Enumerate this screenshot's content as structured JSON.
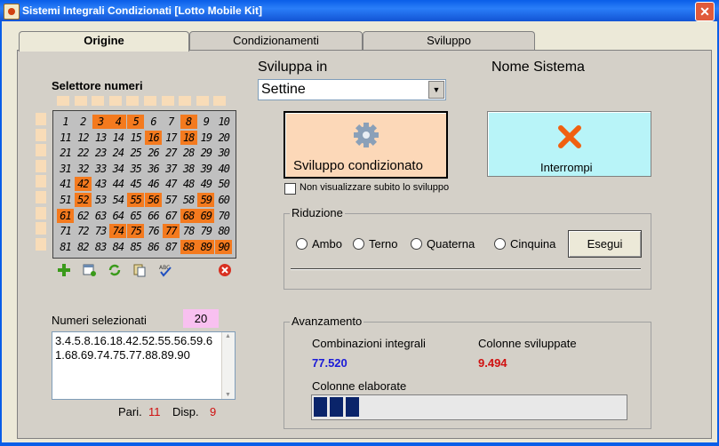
{
  "window": {
    "title": "Sistemi Integrali Condizionati  [Lotto Mobile Kit]",
    "close_glyph": "✕"
  },
  "tabs": [
    {
      "label": "Origine"
    },
    {
      "label": "Condizionamenti"
    },
    {
      "label": "Sviluppo"
    }
  ],
  "selector": {
    "title": "Selettore numeri",
    "rows": [
      [
        1,
        2,
        3,
        4,
        5,
        6,
        7,
        8,
        9,
        10
      ],
      [
        11,
        12,
        13,
        14,
        15,
        16,
        17,
        18,
        19,
        20
      ],
      [
        21,
        22,
        23,
        24,
        25,
        26,
        27,
        28,
        29,
        30
      ],
      [
        31,
        32,
        33,
        34,
        35,
        36,
        37,
        38,
        39,
        40
      ],
      [
        41,
        42,
        43,
        44,
        45,
        46,
        47,
        48,
        49,
        50
      ],
      [
        51,
        52,
        53,
        54,
        55,
        56,
        57,
        58,
        59,
        60
      ],
      [
        61,
        62,
        63,
        64,
        65,
        66,
        67,
        68,
        69,
        70
      ],
      [
        71,
        72,
        73,
        74,
        75,
        76,
        77,
        78,
        79,
        80
      ],
      [
        81,
        82,
        83,
        84,
        85,
        86,
        87,
        88,
        89,
        90
      ]
    ],
    "selected": [
      3,
      4,
      5,
      8,
      16,
      18,
      42,
      52,
      55,
      56,
      59,
      61,
      68,
      69,
      74,
      75,
      77,
      88,
      89,
      90
    ],
    "highlight_color": "#f47a1e",
    "toolbar_icons": [
      "add-icon",
      "new-sheet-icon",
      "refresh-icon",
      "copy-icon",
      "spellcheck-icon",
      "delete-icon"
    ]
  },
  "sviluppa": {
    "label": "Sviluppa in",
    "value": "Settine"
  },
  "nome_sistema": {
    "label": "Nome Sistema"
  },
  "buttons": {
    "sviluppo": "Sviluppo condizionato",
    "interrompi": "Interrompi",
    "esegui": "Esegui"
  },
  "checkbox": {
    "label": "Non visualizzare subito lo sviluppo",
    "checked": false
  },
  "riduzione": {
    "title": "Riduzione",
    "options": [
      "Ambo",
      "Terno",
      "Quaterna",
      "Cinquina"
    ]
  },
  "selected_numbers": {
    "label": "Numeri selezionati",
    "count": "20",
    "text": "3.4.5.8.16.18.42.52.55.56.59.61.68.69.74.75.77.88.89.90"
  },
  "stats": {
    "pari_label": "Pari.",
    "pari": "11",
    "disp_label": "Disp.",
    "disp": "9"
  },
  "avanzamento": {
    "title": "Avanzamento",
    "combinazioni_label": "Combinazioni integrali",
    "combinazioni_value": "77.520",
    "colonne_label": "Colonne sviluppate",
    "colonne_value": "9.494",
    "elaborate_label": "Colonne elaborate",
    "progress_blocks": 3
  }
}
